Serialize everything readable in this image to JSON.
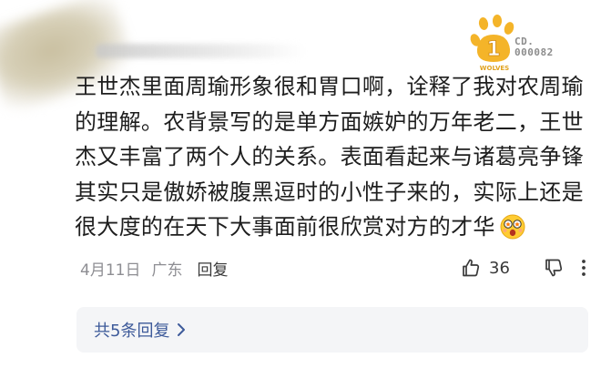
{
  "comment": {
    "lines": [
      "王世杰里面周瑜形象很和胃口啊，诠释了我对农周瑜",
      "的理解。农背景写的是单方面嫉妒的万年老二，王世",
      "杰又丰富了两个人的关系。表面看起来与诸葛亮争锋",
      "其实只是傲娇被腹黑逗时的小性子来的，实际上还是",
      "很大度的在天下大事面前很欣赏对方的才华"
    ]
  },
  "badge": {
    "code_label": "CD.",
    "code_number": "000082",
    "team": "WOLVES",
    "rank": "1"
  },
  "meta": {
    "date": "4月11日",
    "region": "广东",
    "reply": "回复"
  },
  "actions": {
    "like_count": "36"
  },
  "replies": {
    "label": "共5条回复"
  },
  "colors": {
    "accent_link": "#3d5a9a",
    "muted_text": "#8e8e93",
    "badge_gold": "#f2b733",
    "reply_box_bg": "#f4f5f7"
  }
}
